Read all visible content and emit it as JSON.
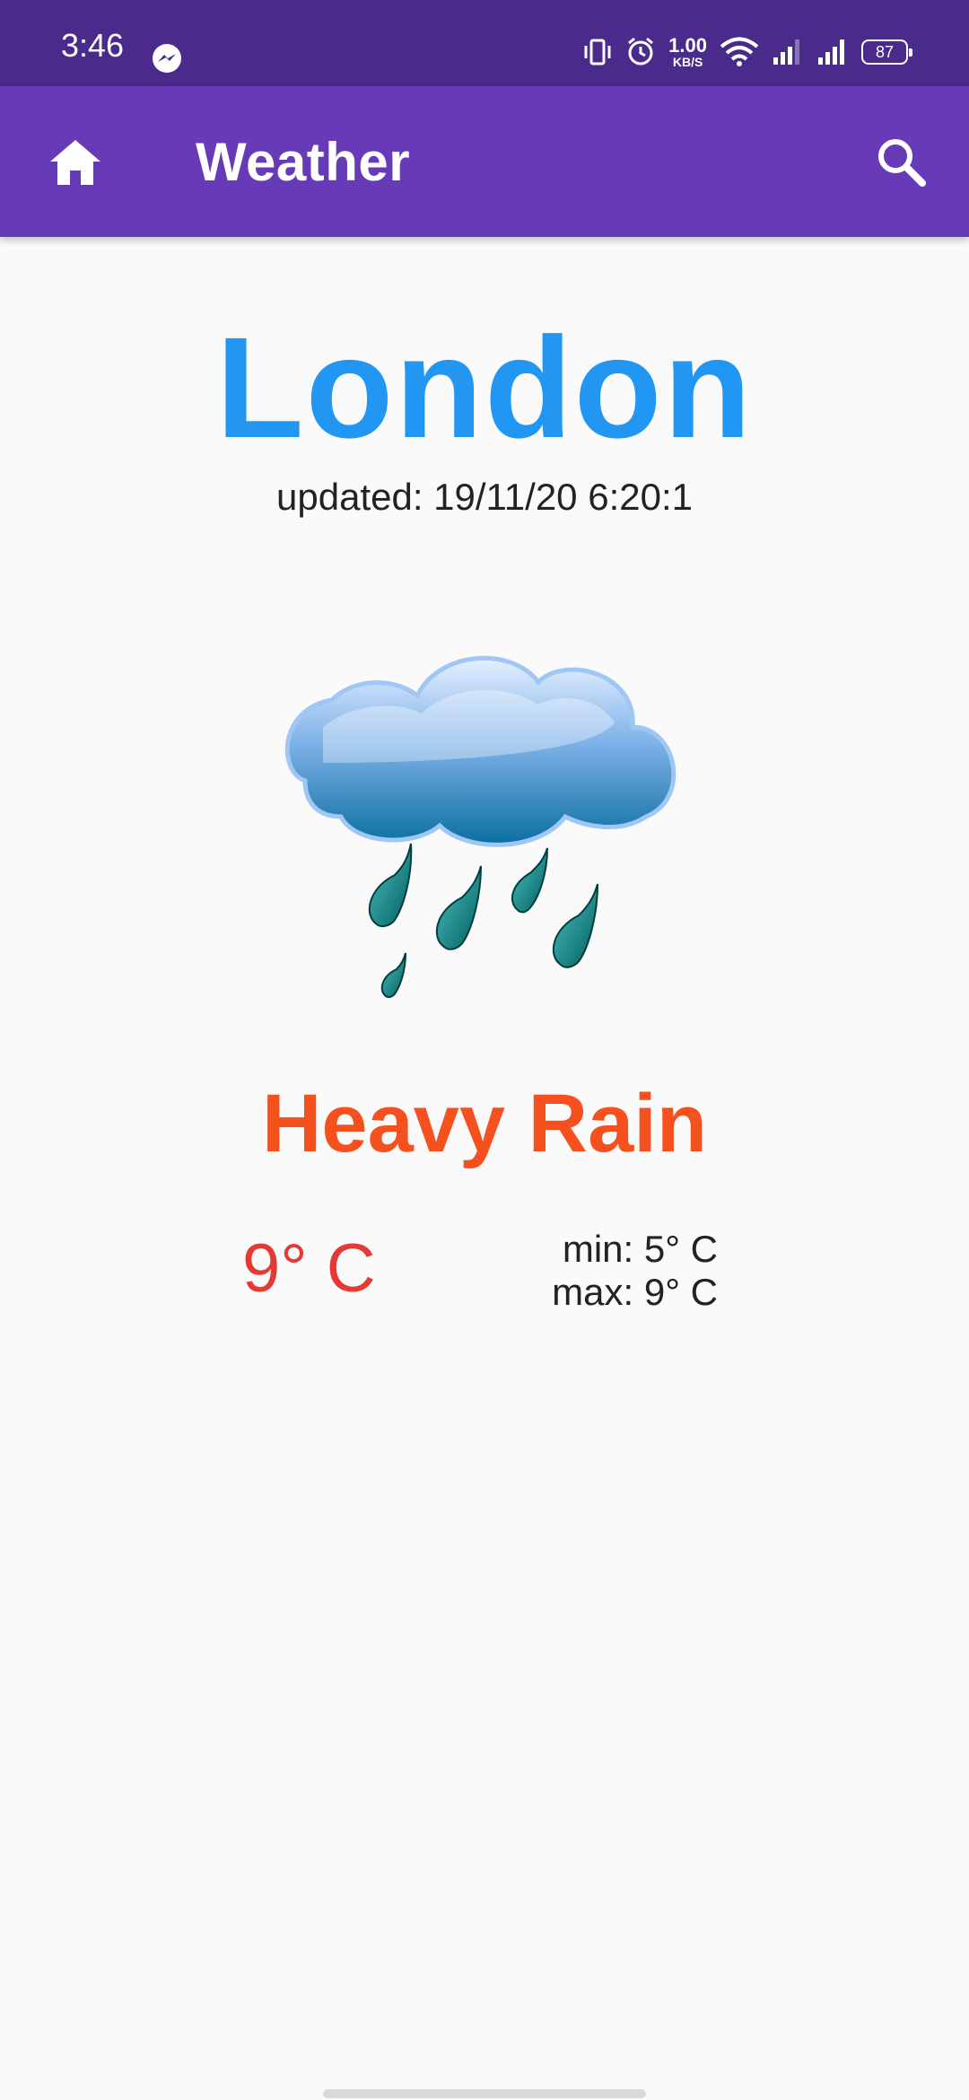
{
  "status_bar": {
    "time": "3:46",
    "net_speed_value": "1.00",
    "net_speed_unit": "KB/S",
    "battery": "87",
    "icons": [
      "messenger-icon",
      "vibrate-icon",
      "alarm-icon",
      "wifi-icon",
      "signal-icon",
      "signal-icon"
    ]
  },
  "app_bar": {
    "title": "Weather",
    "left_icon": "home-icon",
    "right_icon": "search-icon",
    "color": "#673ab7"
  },
  "weather": {
    "city": "London",
    "updated": "updated: 19/11/20 6:20:1",
    "icon": "heavy-rain-icon",
    "condition": "Heavy Rain",
    "temperature": "9° C",
    "min": "min: 5° C",
    "max": "max: 9° C"
  },
  "colors": {
    "city": "#2196f3",
    "condition": "#f4511e",
    "temperature": "#e53935"
  }
}
